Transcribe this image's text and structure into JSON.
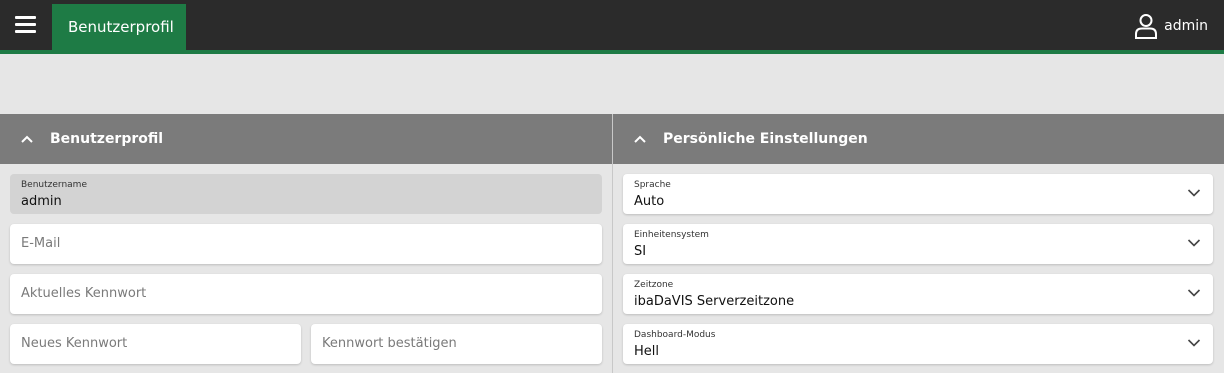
{
  "header": {
    "title": "Benutzerprofil",
    "user": "admin"
  },
  "profile": {
    "heading": "Benutzerprofil",
    "username_label": "Benutzername",
    "username_value": "admin",
    "email_placeholder": "E-Mail",
    "current_password_placeholder": "Aktuelles Kennwort",
    "new_password_placeholder": "Neues Kennwort",
    "confirm_password_placeholder": "Kennwort bestätigen"
  },
  "settings": {
    "heading": "Persönliche Einstellungen",
    "language_label": "Sprache",
    "language_value": "Auto",
    "units_label": "Einheitensystem",
    "units_value": "SI",
    "timezone_label": "Zeitzone",
    "timezone_value": "ibaDaVIS Serverzeitzone",
    "mode_label": "Dashboard-Modus",
    "mode_value": "Hell"
  },
  "colors": {
    "topbar": "#2b2b2b",
    "accent": "#1e7b45",
    "section_header": "#7b7b7b",
    "background": "#e6e6e6"
  }
}
